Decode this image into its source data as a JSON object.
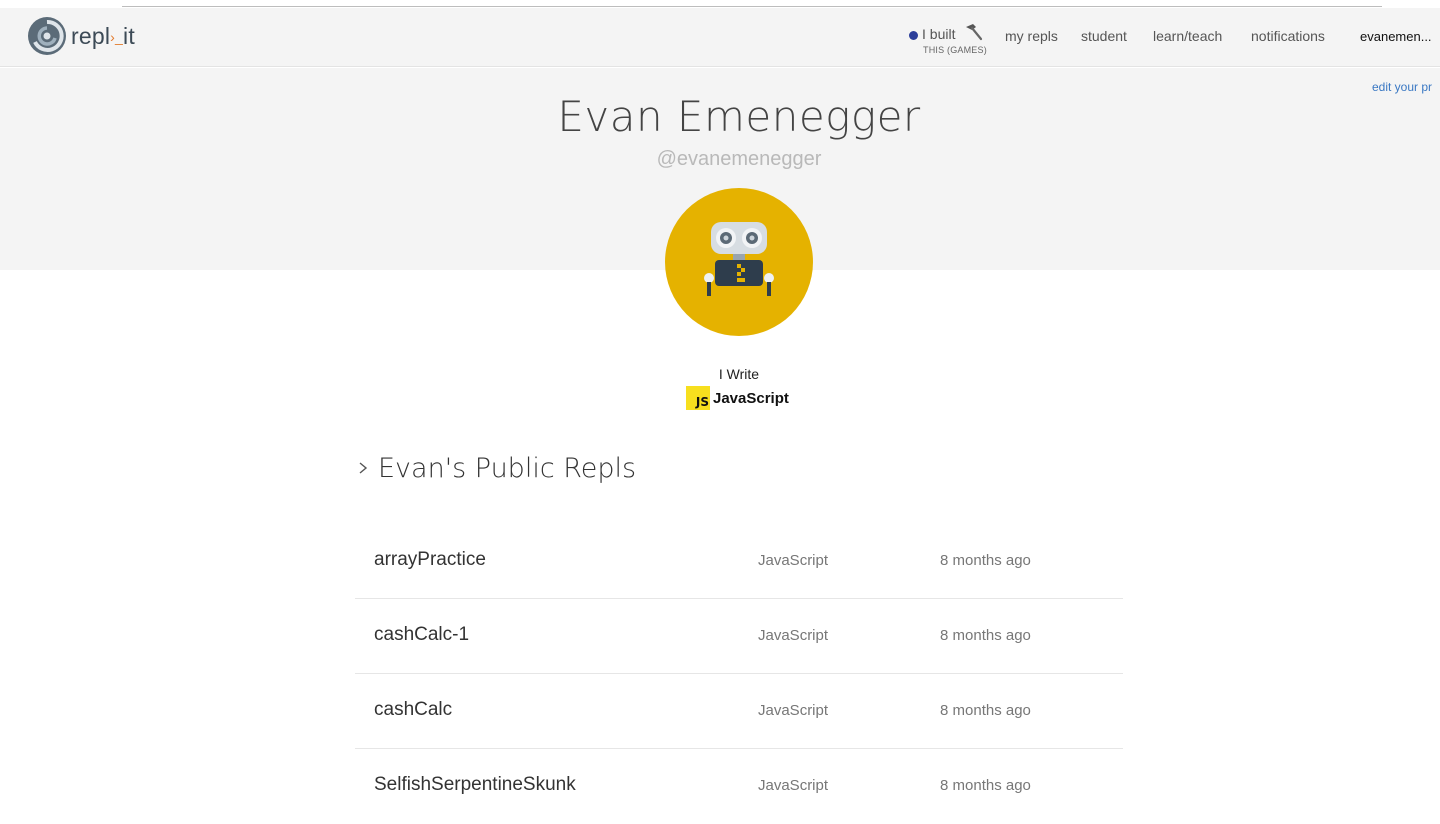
{
  "header": {
    "logo_text_a": "repl",
    "logo_text_sep": "›_",
    "logo_text_b": "it",
    "built": {
      "label": "I built",
      "sub": "THIS (GAMES)"
    },
    "nav": {
      "my_repls": "my repls",
      "student": "student",
      "learn_teach": "learn/teach",
      "notifications": "notifications",
      "user": "evanemen..."
    }
  },
  "profile": {
    "edit_link": "edit your pr",
    "name": "Evan Emenegger",
    "handle": "@evanemenegger",
    "i_write": "I Write",
    "language_badge": "JS",
    "language": "JavaScript"
  },
  "repls": {
    "section_title": "Evan's Public Repls",
    "rows": [
      {
        "name": "arrayPractice",
        "language": "JavaScript",
        "updated": "8 months ago"
      },
      {
        "name": "cashCalc-1",
        "language": "JavaScript",
        "updated": "8 months ago"
      },
      {
        "name": "cashCalc",
        "language": "JavaScript",
        "updated": "8 months ago"
      },
      {
        "name": "SelfishSerpentineSkunk",
        "language": "JavaScript",
        "updated": "8 months ago"
      }
    ]
  },
  "colors": {
    "accent_blue": "#3a78c3",
    "avatar_yellow": "#e5b200",
    "js_yellow": "#f7df1e",
    "hero_bg": "#f4f4f4"
  },
  "icons": {
    "logo": "replit-swirl-icon",
    "hammer": "hammer-icon",
    "chevron": "chevron-right-icon",
    "avatar": "robot-avatar-icon"
  }
}
